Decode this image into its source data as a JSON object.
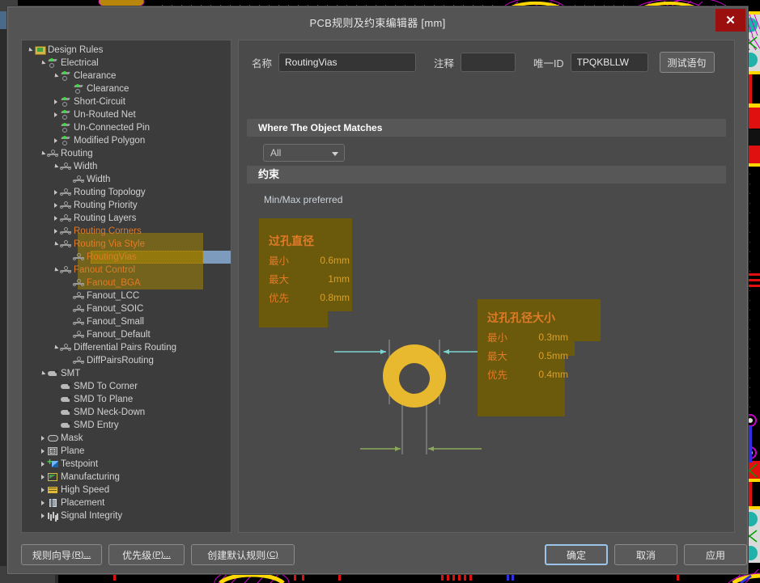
{
  "window": {
    "title": "PCB规则及约束编辑器 [mm]",
    "close_icon": "close-icon",
    "close_label": "✕"
  },
  "tree": {
    "items": [
      {
        "label": "Design Rules",
        "depth": 0,
        "arrow": "open",
        "icon": "folder-icon",
        "highlight": false
      },
      {
        "label": "Electrical",
        "depth": 1,
        "arrow": "open",
        "icon": "electrical-icon",
        "highlight": false
      },
      {
        "label": "Clearance",
        "depth": 2,
        "arrow": "open",
        "icon": "electrical-icon",
        "highlight": false
      },
      {
        "label": "Clearance",
        "depth": 3,
        "arrow": "none",
        "icon": "electrical-icon",
        "highlight": false
      },
      {
        "label": "Short-Circuit",
        "depth": 2,
        "arrow": "closed",
        "icon": "electrical-icon",
        "highlight": false
      },
      {
        "label": "Un-Routed Net",
        "depth": 2,
        "arrow": "closed",
        "icon": "electrical-icon",
        "highlight": false
      },
      {
        "label": "Un-Connected Pin",
        "depth": 2,
        "arrow": "none",
        "icon": "electrical-icon",
        "highlight": false
      },
      {
        "label": "Modified Polygon",
        "depth": 2,
        "arrow": "closed",
        "icon": "electrical-icon",
        "highlight": false
      },
      {
        "label": "Routing",
        "depth": 1,
        "arrow": "open",
        "icon": "routing-icon",
        "highlight": false
      },
      {
        "label": "Width",
        "depth": 2,
        "arrow": "open",
        "icon": "routing-icon",
        "highlight": false
      },
      {
        "label": "Width",
        "depth": 3,
        "arrow": "none",
        "icon": "routing-icon",
        "highlight": false
      },
      {
        "label": "Routing Topology",
        "depth": 2,
        "arrow": "closed",
        "icon": "routing-icon",
        "highlight": false
      },
      {
        "label": "Routing Priority",
        "depth": 2,
        "arrow": "closed",
        "icon": "routing-icon",
        "highlight": false
      },
      {
        "label": "Routing Layers",
        "depth": 2,
        "arrow": "closed",
        "icon": "routing-icon",
        "highlight": false
      },
      {
        "label": "Routing Corners",
        "depth": 2,
        "arrow": "closed",
        "icon": "routing-icon",
        "highlight": true
      },
      {
        "label": "Routing Via Style",
        "depth": 2,
        "arrow": "open",
        "icon": "routing-icon",
        "highlight": true
      },
      {
        "label": "RoutingVias",
        "depth": 3,
        "arrow": "none",
        "icon": "routing-icon",
        "highlight": true,
        "selected": true
      },
      {
        "label": "Fanout Control",
        "depth": 2,
        "arrow": "open",
        "icon": "routing-icon",
        "highlight": true
      },
      {
        "label": "Fanout_BGA",
        "depth": 3,
        "arrow": "none",
        "icon": "routing-icon",
        "highlight": true
      },
      {
        "label": "Fanout_LCC",
        "depth": 3,
        "arrow": "none",
        "icon": "routing-icon",
        "highlight": false
      },
      {
        "label": "Fanout_SOIC",
        "depth": 3,
        "arrow": "none",
        "icon": "routing-icon",
        "highlight": false
      },
      {
        "label": "Fanout_Small",
        "depth": 3,
        "arrow": "none",
        "icon": "routing-icon",
        "highlight": false
      },
      {
        "label": "Fanout_Default",
        "depth": 3,
        "arrow": "none",
        "icon": "routing-icon",
        "highlight": false
      },
      {
        "label": "Differential Pairs Routing",
        "depth": 2,
        "arrow": "open",
        "icon": "routing-icon",
        "highlight": false
      },
      {
        "label": "DiffPairsRouting",
        "depth": 3,
        "arrow": "none",
        "icon": "routing-icon",
        "highlight": false
      },
      {
        "label": "SMT",
        "depth": 1,
        "arrow": "open",
        "icon": "smd-icon",
        "highlight": false
      },
      {
        "label": "SMD To Corner",
        "depth": 2,
        "arrow": "none",
        "icon": "smd-icon",
        "highlight": false
      },
      {
        "label": "SMD To Plane",
        "depth": 2,
        "arrow": "none",
        "icon": "smd-icon",
        "highlight": false
      },
      {
        "label": "SMD Neck-Down",
        "depth": 2,
        "arrow": "none",
        "icon": "smd-icon",
        "highlight": false
      },
      {
        "label": "SMD Entry",
        "depth": 2,
        "arrow": "none",
        "icon": "smd-icon",
        "highlight": false
      },
      {
        "label": "Mask",
        "depth": 1,
        "arrow": "closed",
        "icon": "mask-icon",
        "highlight": false
      },
      {
        "label": "Plane",
        "depth": 1,
        "arrow": "closed",
        "icon": "plane-icon",
        "highlight": false
      },
      {
        "label": "Testpoint",
        "depth": 1,
        "arrow": "closed",
        "icon": "testpoint-icon",
        "highlight": false
      },
      {
        "label": "Manufacturing",
        "depth": 1,
        "arrow": "closed",
        "icon": "manufacturing-icon",
        "highlight": false
      },
      {
        "label": "High Speed",
        "depth": 1,
        "arrow": "closed",
        "icon": "highspeed-icon",
        "highlight": false
      },
      {
        "label": "Placement",
        "depth": 1,
        "arrow": "closed",
        "icon": "placement-icon",
        "highlight": false
      },
      {
        "label": "Signal Integrity",
        "depth": 1,
        "arrow": "closed",
        "icon": "signalintegrity-icon",
        "highlight": false
      }
    ]
  },
  "form": {
    "name_label": "名称",
    "name_value": "RoutingVias",
    "comment_label": "注释",
    "comment_value": "",
    "uid_label": "唯一ID",
    "uid_value": "TPQKBLLW",
    "test_query_button": "测试语句"
  },
  "match_section": {
    "header": "Where The Object Matches",
    "scope_value": "All",
    "caret_icon": "chevron-down-icon"
  },
  "constraint_section": {
    "header": "约束",
    "minmax_label": "Min/Max preferred",
    "via_diameter": {
      "title": "过孔直径",
      "rows": [
        {
          "key": "最小",
          "value": "0.6mm"
        },
        {
          "key": "最大",
          "value": "1mm"
        },
        {
          "key": "优先",
          "value": "0.8mm"
        }
      ]
    },
    "via_hole_size": {
      "title": "过孔孔径大小",
      "rows": [
        {
          "key": "最小",
          "value": "0.3mm"
        },
        {
          "key": "最大",
          "value": "0.5mm"
        },
        {
          "key": "优先",
          "value": "0.4mm"
        }
      ]
    }
  },
  "footer": {
    "rule_wizard": "规则向导",
    "rule_wizard_mn": "(R)...",
    "priority": "优先级",
    "priority_mn": "(P)...",
    "create_default": "创建默认规则",
    "create_default_mn": "(C)",
    "ok": "确定",
    "cancel": "取消",
    "apply": "应用"
  },
  "colors": {
    "accent_orange": "#e07b28",
    "value_gold": "#d9a02a",
    "via_gold": "#e8b92e",
    "highlight_olive": "#6b5a0c",
    "selection_blue": "#7d9cbd",
    "close_red": "#9c0f0f",
    "dialog_bg": "#545454",
    "panel_bg": "#4a4a4a",
    "tree_bg": "#3c3c3c"
  }
}
